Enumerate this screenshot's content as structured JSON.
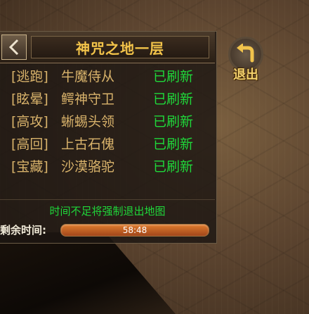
{
  "panel": {
    "title": "神咒之地一层",
    "rows": [
      {
        "tag": "[逃跑]",
        "boss": "牛魔侍从",
        "status": "已刷新"
      },
      {
        "tag": "[眩晕]",
        "boss": "鳄神守卫",
        "status": "已刷新"
      },
      {
        "tag": "[高攻]",
        "boss": "蜥蜴头领",
        "status": "已刷新"
      },
      {
        "tag": "[高回]",
        "boss": "上古石傀",
        "status": "已刷新"
      },
      {
        "tag": "[宝藏]",
        "boss": "沙漠骆驼",
        "status": "已刷新"
      }
    ],
    "notice": "时间不足将强制退出地图",
    "timer_label": "剩余时间:",
    "timer_value": "58:48"
  },
  "exit_button": {
    "label": "退出",
    "icon": "exit-arrow-icon"
  },
  "icons": {
    "back": "chevron-left-icon"
  },
  "colors": {
    "title": "#f3c44a",
    "text": "#d9b36b",
    "status": "#1fd83a",
    "timer_bar": "#e07c2e"
  }
}
